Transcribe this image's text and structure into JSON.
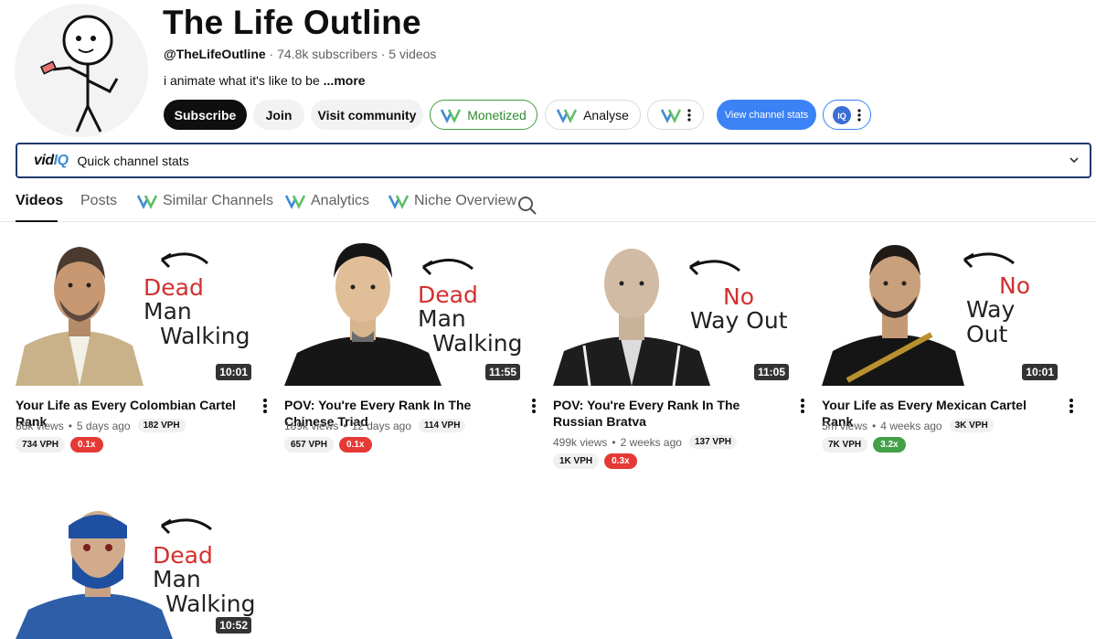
{
  "channel": {
    "name": "The Life Outline",
    "handle": "@TheLifeOutline",
    "subscribers": "74.8k subscribers",
    "videos_count": "5 videos",
    "description": "i animate what it's like to be",
    "more": "...more"
  },
  "buttons": {
    "subscribe": "Subscribe",
    "join": "Join",
    "visit_community": "Visit community",
    "monetized": "Monetized",
    "analyse": "Analyse",
    "view_channel_stats": "View channel stats"
  },
  "vidiq": {
    "logo_a": "vid",
    "logo_b": "IQ",
    "label": "Quick channel stats"
  },
  "tabs": {
    "videos": "Videos",
    "posts": "Posts",
    "similar": "Similar Channels",
    "analytics": "Analytics",
    "niche": "Niche Overview"
  },
  "videos": [
    {
      "title": "Your Life as Every Colombian Cartel Rank",
      "views": "88k views",
      "age": "5 days ago",
      "vph": "182 VPH",
      "vph2": "734 VPH",
      "mult": "0.1x",
      "mult_color": "red",
      "duration": "10:01",
      "thumb_line1": "Dead",
      "thumb_line1b": "Man",
      "thumb_line2": "Walking"
    },
    {
      "title": "POV: You're Every Rank In The Chinese Triad",
      "views": "189k views",
      "age": "12 days ago",
      "vph": "114 VPH",
      "vph2": "657 VPH",
      "mult": "0.1x",
      "mult_color": "red",
      "duration": "11:55",
      "thumb_line1": "Dead",
      "thumb_line1b": "Man",
      "thumb_line2": "Walking"
    },
    {
      "title": "POV: You're Every Rank In The Russian Bratva",
      "views": "499k views",
      "age": "2 weeks ago",
      "vph": "137 VPH",
      "vph2": "1K VPH",
      "mult": "0.3x",
      "mult_color": "red",
      "duration": "11:05",
      "thumb_line1": "No",
      "thumb_line2": "Way Out"
    },
    {
      "title": "Your Life as Every Mexican Cartel Rank",
      "views": "5m views",
      "age": "4 weeks ago",
      "vph": "3K VPH",
      "vph2": "7K VPH",
      "mult": "3.2x",
      "mult_color": "green",
      "duration": "10:01",
      "thumb_line1": "No",
      "thumb_line2": "Way Out"
    },
    {
      "duration": "10:52",
      "thumb_line1": "Dead",
      "thumb_line1b": "Man",
      "thumb_line2": "Walking"
    }
  ],
  "colors": {
    "accent_blue": "#3b82f6",
    "monetized_green": "#2e8b2e",
    "mult_red": "#e53935",
    "mult_green": "#43a047",
    "vidiq_border": "#1f3a6e"
  }
}
